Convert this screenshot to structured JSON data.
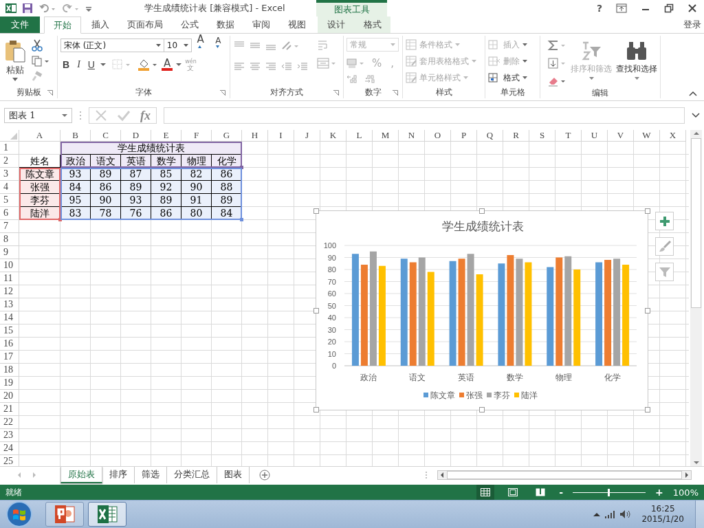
{
  "window": {
    "title": "学生成绩统计表  [兼容模式] - Excel",
    "context_group": "图表工具",
    "help": "?",
    "signin": "登录"
  },
  "ribbon_tabs": [
    {
      "label": "文件",
      "kind": "file",
      "selected": false
    },
    {
      "label": "开始",
      "kind": "normal",
      "selected": true
    },
    {
      "label": "插入",
      "kind": "normal",
      "selected": false
    },
    {
      "label": "页面布局",
      "kind": "normal",
      "selected": false
    },
    {
      "label": "公式",
      "kind": "normal",
      "selected": false
    },
    {
      "label": "数据",
      "kind": "normal",
      "selected": false
    },
    {
      "label": "审阅",
      "kind": "normal",
      "selected": false
    },
    {
      "label": "视图",
      "kind": "normal",
      "selected": false
    },
    {
      "label": "设计",
      "kind": "context",
      "selected": false
    },
    {
      "label": "格式",
      "kind": "context",
      "selected": false
    }
  ],
  "ribbon": {
    "clipboard": {
      "label": "剪贴板",
      "paste": "粘贴"
    },
    "font": {
      "label": "字体",
      "font_name": "宋体 (正文)",
      "font_size": "10",
      "grow": "A",
      "shrink": "A",
      "styles": [
        "B",
        "I",
        "U"
      ],
      "font_color": "A",
      "phonetic": "wén",
      "phonetic_char": "文"
    },
    "alignment": {
      "label": "对齐方式"
    },
    "number": {
      "label": "数字",
      "format": "常规",
      "format_disabled": true,
      "symbols": [
        "%",
        ","
      ]
    },
    "styles": {
      "label": "样式",
      "items": [
        {
          "label": "条件格式",
          "kind": "conditional",
          "disabled": true
        },
        {
          "label": "套用表格格式",
          "kind": "table",
          "disabled": true
        },
        {
          "label": "单元格样式",
          "kind": "cell",
          "disabled": true
        }
      ]
    },
    "cells": {
      "label": "单元格",
      "items": [
        {
          "label": "插入",
          "kind": "insert",
          "disabled": true
        },
        {
          "label": "删除",
          "kind": "delete",
          "disabled": true
        },
        {
          "label": "格式",
          "kind": "format",
          "disabled": false
        }
      ]
    },
    "editing": {
      "label": "编辑",
      "items": [
        {
          "label": "排序和筛选",
          "kind": "sort",
          "disabled": true
        },
        {
          "label": "查找和选择",
          "kind": "find",
          "disabled": false
        }
      ]
    }
  },
  "formula_bar": {
    "name_box": "图表 1",
    "fx": "fx"
  },
  "sheet": {
    "columns": [
      "A",
      "B",
      "C",
      "D",
      "E",
      "F",
      "G",
      "H",
      "I",
      "J",
      "K",
      "L",
      "M",
      "N",
      "O",
      "P",
      "Q",
      "R",
      "S",
      "T",
      "U",
      "V",
      "W",
      "X"
    ],
    "rows": [
      "1",
      "2",
      "3",
      "4",
      "5",
      "6",
      "7",
      "8",
      "9",
      "10",
      "11",
      "12",
      "13",
      "14",
      "15",
      "16",
      "17",
      "18",
      "19",
      "20",
      "21",
      "22",
      "23",
      "24",
      "25"
    ],
    "title": "学生成绩统计表",
    "header": [
      "姓名",
      "政治",
      "语文",
      "英语",
      "数学",
      "物理",
      "化学"
    ],
    "records": [
      {
        "name": "陈文章",
        "scores": [
          "93",
          "89",
          "87",
          "85",
          "82",
          "86"
        ]
      },
      {
        "name": "张强",
        "scores": [
          "84",
          "86",
          "89",
          "92",
          "90",
          "88"
        ]
      },
      {
        "name": "李芬",
        "scores": [
          "95",
          "90",
          "93",
          "89",
          "91",
          "89"
        ]
      },
      {
        "name": "陆洋",
        "scores": [
          "83",
          "78",
          "76",
          "86",
          "80",
          "84"
        ]
      }
    ],
    "chart_selected": true
  },
  "chart": {
    "chart_data": {
      "type": "bar",
      "title": "学生成绩统计表",
      "categories": [
        "政治",
        "语文",
        "英语",
        "数学",
        "物理",
        "化学"
      ],
      "series": [
        {
          "name": "陈文章",
          "color": "#5b9bd5",
          "values": [
            93,
            89,
            87,
            85,
            82,
            86
          ]
        },
        {
          "name": "张强",
          "color": "#ed7d31",
          "values": [
            84,
            86,
            89,
            92,
            90,
            88
          ]
        },
        {
          "name": "李芬",
          "color": "#a5a5a5",
          "values": [
            95,
            90,
            93,
            89,
            91,
            89
          ]
        },
        {
          "name": "陆洋",
          "color": "#ffc000",
          "values": [
            83,
            78,
            76,
            86,
            80,
            84
          ]
        }
      ],
      "ylim": [
        0,
        100
      ],
      "yticks": [
        {
          "value": 0,
          "label": "0"
        },
        {
          "value": 10,
          "label": "10"
        },
        {
          "value": 20,
          "label": "20"
        },
        {
          "value": 30,
          "label": "30"
        },
        {
          "value": 40,
          "label": "40"
        },
        {
          "value": 50,
          "label": "50"
        },
        {
          "value": 60,
          "label": "60"
        },
        {
          "value": 70,
          "label": "70"
        },
        {
          "value": 80,
          "label": "80"
        },
        {
          "value": 90,
          "label": "90"
        },
        {
          "value": 100,
          "label": "100"
        }
      ],
      "grid": true,
      "legend": true
    }
  },
  "sheet_tabs": [
    {
      "label": "原始表",
      "selected": true
    },
    {
      "label": "排序",
      "selected": false
    },
    {
      "label": "筛选",
      "selected": false
    },
    {
      "label": "分类汇总",
      "selected": false
    },
    {
      "label": "图表",
      "selected": false
    }
  ],
  "status_bar": {
    "status": "就绪",
    "views": [
      {
        "kind": "normal",
        "selected": true
      },
      {
        "kind": "page_layout",
        "selected": false
      },
      {
        "kind": "page_break",
        "selected": false
      }
    ],
    "zoom_out": "-",
    "zoom_in": "+",
    "zoom": {
      "level": 0.5
    },
    "zoom_reading": "100%"
  },
  "taskbar": {
    "apps": [
      {
        "kind": "powerpoint",
        "selected": false
      },
      {
        "kind": "excel",
        "selected": true
      }
    ],
    "time": "16:25",
    "date": "2015/1/20"
  }
}
